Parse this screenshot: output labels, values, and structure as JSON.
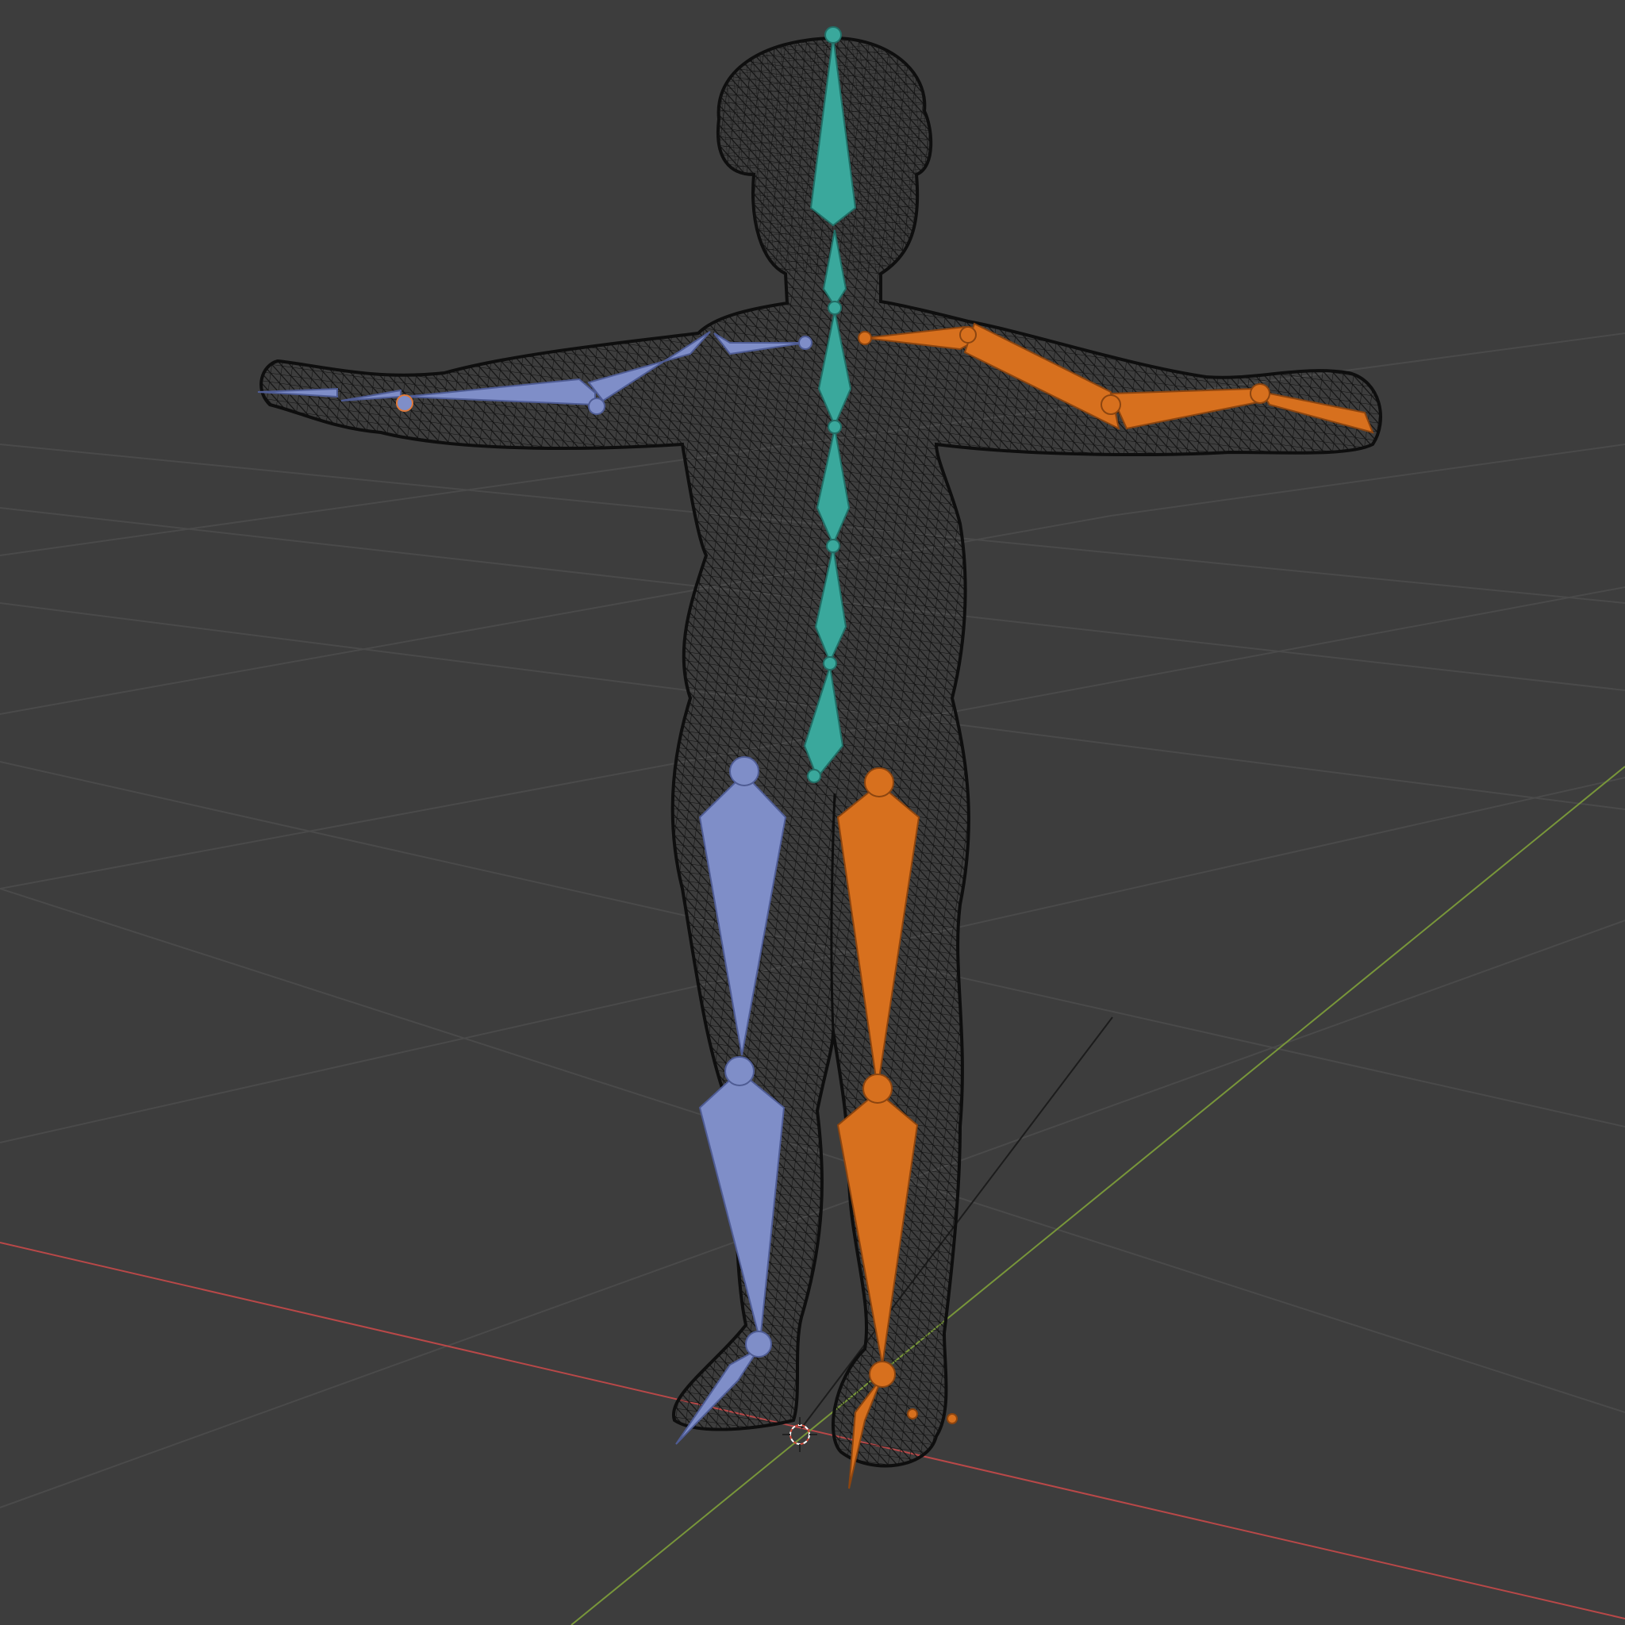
{
  "viewport": {
    "mode": "wireframe",
    "background_color": "#3d3d3d",
    "grid_color": "#4a4a4a",
    "axis_x_color": "#c84a4a",
    "axis_y_color": "#7d9a3a",
    "mesh_color": "#111111"
  },
  "armature": {
    "spine_color": "#3aa89c",
    "left_side_color": "#7f8ec8",
    "right_side_color": "#d7701e"
  }
}
